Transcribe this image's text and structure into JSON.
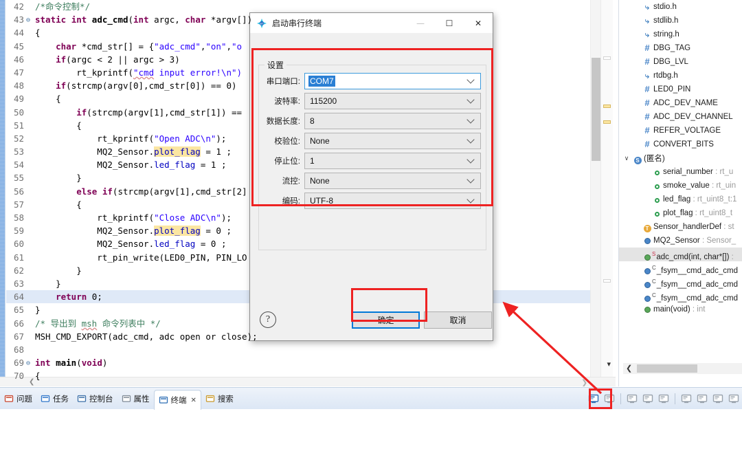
{
  "editor": {
    "lines": [
      {
        "num": "42",
        "fold": "",
        "current": false,
        "segs": [
          {
            "t": "/*命令控制*/",
            "c": "cmt"
          }
        ]
      },
      {
        "num": "43",
        "fold": "⊖",
        "current": false,
        "segs": [
          {
            "t": "static",
            "c": "kw"
          },
          {
            "t": " ",
            "c": "pln"
          },
          {
            "t": "int",
            "c": "kw"
          },
          {
            "t": " ",
            "c": "pln"
          },
          {
            "t": "adc_cmd",
            "c": "fn"
          },
          {
            "t": "(",
            "c": "pln"
          },
          {
            "t": "int",
            "c": "kw"
          },
          {
            "t": " argc, ",
            "c": "pln"
          },
          {
            "t": "char",
            "c": "kw"
          },
          {
            "t": " *argv[])",
            "c": "pln"
          }
        ]
      },
      {
        "num": "44",
        "fold": "",
        "current": false,
        "segs": [
          {
            "t": "{",
            "c": "pln"
          }
        ]
      },
      {
        "num": "45",
        "fold": "",
        "current": false,
        "segs": [
          {
            "t": "    ",
            "c": "pln"
          },
          {
            "t": "char",
            "c": "kw"
          },
          {
            "t": " *cmd_str[] = {",
            "c": "pln"
          },
          {
            "t": "\"adc_cmd\"",
            "c": "str"
          },
          {
            "t": ",",
            "c": "pln"
          },
          {
            "t": "\"on\"",
            "c": "str"
          },
          {
            "t": ",",
            "c": "pln"
          },
          {
            "t": "\"o",
            "c": "str"
          }
        ]
      },
      {
        "num": "46",
        "fold": "",
        "current": false,
        "segs": [
          {
            "t": "    ",
            "c": "pln"
          },
          {
            "t": "if",
            "c": "kw"
          },
          {
            "t": "(argc < 2 || argc > 3)",
            "c": "pln"
          }
        ]
      },
      {
        "num": "47",
        "fold": "",
        "current": false,
        "segs": [
          {
            "t": "        rt_kprintf(",
            "c": "pln"
          },
          {
            "t": "\"cmd",
            "c": "str wavy"
          },
          {
            "t": " input error!\\n\")",
            "c": "str"
          }
        ]
      },
      {
        "num": "48",
        "fold": "",
        "current": false,
        "segs": [
          {
            "t": "    ",
            "c": "pln"
          },
          {
            "t": "if",
            "c": "kw"
          },
          {
            "t": "(strcmp(argv[0],cmd_str[0]) == 0)",
            "c": "pln"
          }
        ]
      },
      {
        "num": "49",
        "fold": "",
        "current": false,
        "segs": [
          {
            "t": "    {",
            "c": "pln"
          }
        ]
      },
      {
        "num": "50",
        "fold": "",
        "current": false,
        "segs": [
          {
            "t": "        ",
            "c": "pln"
          },
          {
            "t": "if",
            "c": "kw"
          },
          {
            "t": "(strcmp(argv[1],cmd_str[1]) ==",
            "c": "pln"
          }
        ]
      },
      {
        "num": "51",
        "fold": "",
        "current": false,
        "segs": [
          {
            "t": "        {",
            "c": "pln"
          }
        ]
      },
      {
        "num": "52",
        "fold": "",
        "current": false,
        "segs": [
          {
            "t": "            rt_kprintf(",
            "c": "pln"
          },
          {
            "t": "\"Open ADC\\n\"",
            "c": "str"
          },
          {
            "t": ");",
            "c": "pln"
          }
        ]
      },
      {
        "num": "53",
        "fold": "",
        "current": false,
        "segs": [
          {
            "t": "            MQ2_Sensor.",
            "c": "pln"
          },
          {
            "t": "plot_flag",
            "c": "fld hl"
          },
          {
            "t": " = 1 ;",
            "c": "pln"
          }
        ]
      },
      {
        "num": "54",
        "fold": "",
        "current": false,
        "segs": [
          {
            "t": "            MQ2_Sensor.",
            "c": "pln"
          },
          {
            "t": "led_flag",
            "c": "fld"
          },
          {
            "t": " = 1 ;",
            "c": "pln"
          }
        ]
      },
      {
        "num": "55",
        "fold": "",
        "current": false,
        "segs": [
          {
            "t": "        }",
            "c": "pln"
          }
        ]
      },
      {
        "num": "56",
        "fold": "",
        "current": false,
        "segs": [
          {
            "t": "        ",
            "c": "pln"
          },
          {
            "t": "else",
            "c": "kw"
          },
          {
            "t": " ",
            "c": "pln"
          },
          {
            "t": "if",
            "c": "kw"
          },
          {
            "t": "(strcmp(argv[1],cmd_str[2]",
            "c": "pln"
          }
        ]
      },
      {
        "num": "57",
        "fold": "",
        "current": false,
        "segs": [
          {
            "t": "        {",
            "c": "pln"
          }
        ]
      },
      {
        "num": "58",
        "fold": "",
        "current": false,
        "segs": [
          {
            "t": "            rt_kprintf(",
            "c": "pln"
          },
          {
            "t": "\"Close ADC\\n\"",
            "c": "str"
          },
          {
            "t": ");",
            "c": "pln"
          }
        ]
      },
      {
        "num": "59",
        "fold": "",
        "current": false,
        "segs": [
          {
            "t": "            MQ2_Sensor.",
            "c": "pln"
          },
          {
            "t": "plot_flag",
            "c": "fld hl"
          },
          {
            "t": " = 0 ;",
            "c": "pln"
          }
        ]
      },
      {
        "num": "60",
        "fold": "",
        "current": false,
        "segs": [
          {
            "t": "            MQ2_Sensor.",
            "c": "pln"
          },
          {
            "t": "led_flag",
            "c": "fld"
          },
          {
            "t": " = 0 ;",
            "c": "pln"
          }
        ]
      },
      {
        "num": "61",
        "fold": "",
        "current": false,
        "segs": [
          {
            "t": "            rt_pin_write(LED0_PIN, PIN_LO",
            "c": "pln"
          }
        ]
      },
      {
        "num": "62",
        "fold": "",
        "current": false,
        "segs": [
          {
            "t": "        }",
            "c": "pln"
          }
        ]
      },
      {
        "num": "63",
        "fold": "",
        "current": false,
        "segs": [
          {
            "t": "    }",
            "c": "pln"
          }
        ]
      },
      {
        "num": "64",
        "fold": "",
        "current": true,
        "segs": [
          {
            "t": "    ",
            "c": "pln"
          },
          {
            "t": "return",
            "c": "kw"
          },
          {
            "t": " 0;",
            "c": "pln"
          }
        ]
      },
      {
        "num": "65",
        "fold": "",
        "current": false,
        "segs": [
          {
            "t": "}",
            "c": "pln"
          }
        ]
      },
      {
        "num": "66",
        "fold": "",
        "current": false,
        "segs": [
          {
            "t": "/* 导出到 ",
            "c": "cmt"
          },
          {
            "t": "msh",
            "c": "cmt wavy"
          },
          {
            "t": " 命令列表中 */",
            "c": "cmt"
          }
        ]
      },
      {
        "num": "67",
        "fold": "",
        "current": false,
        "segs": [
          {
            "t": "MSH_CMD_EXPORT(adc_cmd, adc open or close);",
            "c": "pln"
          }
        ]
      },
      {
        "num": "68",
        "fold": "",
        "current": false,
        "segs": [
          {
            "t": "",
            "c": "pln"
          }
        ]
      },
      {
        "num": "69",
        "fold": "⊖",
        "current": false,
        "segs": [
          {
            "t": "int",
            "c": "kw"
          },
          {
            "t": " ",
            "c": "pln"
          },
          {
            "t": "main",
            "c": "fn"
          },
          {
            "t": "(",
            "c": "pln"
          },
          {
            "t": "void",
            "c": "kw"
          },
          {
            "t": ")",
            "c": "pln"
          }
        ]
      },
      {
        "num": "70",
        "fold": "",
        "current": false,
        "segs": [
          {
            "t": "{",
            "c": "pln"
          }
        ]
      }
    ]
  },
  "outline": {
    "items": [
      {
        "indent": 1,
        "twisty": "",
        "icon": "include-icon",
        "iconGlyph": "⤷",
        "iconClass": "ic-hdr",
        "name": "stdio.h",
        "type": "",
        "selected": false
      },
      {
        "indent": 1,
        "twisty": "",
        "icon": "include-icon",
        "iconGlyph": "⤷",
        "iconClass": "ic-hdr",
        "name": "stdlib.h",
        "type": "",
        "selected": false
      },
      {
        "indent": 1,
        "twisty": "",
        "icon": "include-icon",
        "iconGlyph": "⤷",
        "iconClass": "ic-hdr",
        "name": "string.h",
        "type": "",
        "selected": false
      },
      {
        "indent": 1,
        "twisty": "",
        "icon": "define-icon",
        "iconGlyph": "#",
        "iconClass": "ic-def",
        "name": "DBG_TAG",
        "type": "",
        "selected": false
      },
      {
        "indent": 1,
        "twisty": "",
        "icon": "define-icon",
        "iconGlyph": "#",
        "iconClass": "ic-def",
        "name": "DBG_LVL",
        "type": "",
        "selected": false
      },
      {
        "indent": 1,
        "twisty": "",
        "icon": "include-icon",
        "iconGlyph": "⤷",
        "iconClass": "ic-hdr",
        "name": "rtdbg.h",
        "type": "",
        "selected": false
      },
      {
        "indent": 1,
        "twisty": "",
        "icon": "define-icon",
        "iconGlyph": "#",
        "iconClass": "ic-def",
        "name": "LED0_PIN",
        "type": "",
        "selected": false
      },
      {
        "indent": 1,
        "twisty": "",
        "icon": "define-icon",
        "iconGlyph": "#",
        "iconClass": "ic-def",
        "name": "ADC_DEV_NAME",
        "type": "",
        "selected": false
      },
      {
        "indent": 1,
        "twisty": "",
        "icon": "define-icon",
        "iconGlyph": "#",
        "iconClass": "ic-def",
        "name": "ADC_DEV_CHANNEL",
        "type": "",
        "selected": false
      },
      {
        "indent": 1,
        "twisty": "",
        "icon": "define-icon",
        "iconGlyph": "#",
        "iconClass": "ic-def",
        "name": "REFER_VOLTAGE",
        "type": "",
        "selected": false
      },
      {
        "indent": 1,
        "twisty": "",
        "icon": "define-icon",
        "iconGlyph": "#",
        "iconClass": "ic-def",
        "name": "CONVERT_BITS",
        "type": "",
        "selected": false
      },
      {
        "indent": 0,
        "twisty": "∨",
        "icon": "struct-icon",
        "iconGlyph": "S",
        "iconClass": "circ-s",
        "name": "(匿名)",
        "type": "",
        "selected": false
      },
      {
        "indent": 2,
        "twisty": "",
        "icon": "field-icon",
        "iconGlyph": "○",
        "iconClass": "dot-ring",
        "name": "serial_number",
        "type": " : rt_u",
        "selected": false
      },
      {
        "indent": 2,
        "twisty": "",
        "icon": "field-icon",
        "iconGlyph": "○",
        "iconClass": "dot-ring",
        "name": "smoke_value",
        "type": " : rt_uin",
        "selected": false
      },
      {
        "indent": 2,
        "twisty": "",
        "icon": "field-icon",
        "iconGlyph": "○",
        "iconClass": "dot-ring",
        "name": "led_flag",
        "type": " : rt_uint8_t:1",
        "selected": false
      },
      {
        "indent": 2,
        "twisty": "",
        "icon": "field-icon",
        "iconGlyph": "○",
        "iconClass": "dot-ring",
        "name": "plot_flag",
        "type": " : rt_uint8_t",
        "selected": false
      },
      {
        "indent": 1,
        "twisty": "",
        "icon": "typedef-icon",
        "iconGlyph": "T",
        "iconClass": "circ-t",
        "name": "Sensor_handlerDef",
        "type": " : st",
        "selected": false
      },
      {
        "indent": 1,
        "twisty": "",
        "icon": "variable-icon",
        "iconGlyph": "●",
        "iconClass": "dot-blue",
        "name": "MQ2_Sensor",
        "type": " : Sensor_",
        "selected": false
      },
      {
        "indent": 1,
        "twisty": "",
        "icon": "function-icon",
        "iconGlyph": "●",
        "iconClass": "dot-green",
        "name": "adc_cmd(int, char*[])",
        "type": " :",
        "badge": "S",
        "badgeClass": "badge-s",
        "selected": true
      },
      {
        "indent": 1,
        "twisty": "",
        "icon": "variable-icon",
        "iconGlyph": "●",
        "iconClass": "dot-blue",
        "name": "_fsym__cmd_adc_cmd",
        "type": "",
        "badge": "C",
        "badgeClass": "badge-c",
        "selected": false
      },
      {
        "indent": 1,
        "twisty": "",
        "icon": "variable-icon",
        "iconGlyph": "●",
        "iconClass": "dot-blue",
        "name": "_fsym__cmd_adc_cmd",
        "type": "",
        "badge": "C",
        "badgeClass": "badge-c",
        "selected": false
      },
      {
        "indent": 1,
        "twisty": "",
        "icon": "variable-icon",
        "iconGlyph": "●",
        "iconClass": "dot-blue",
        "name": "_fsym__cmd_adc_cmd",
        "type": "",
        "badge": "C",
        "badgeClass": "badge-c",
        "selected": false
      },
      {
        "indent": 1,
        "twisty": "",
        "icon": "function-icon",
        "iconGlyph": "●",
        "iconClass": "dot-green",
        "name": "main(void)",
        "type": " : int",
        "selected": false
      }
    ]
  },
  "dialog": {
    "title": "启动串行终端",
    "minimize_label": "—",
    "maximize_label": "☐",
    "close_label": "✕",
    "group_legend": "设置",
    "fields": [
      {
        "label": "串口端口:",
        "value": "COM7",
        "editable": true,
        "name": "serial-port"
      },
      {
        "label": "波特率:",
        "value": "115200",
        "editable": false,
        "name": "baud-rate"
      },
      {
        "label": "数据长度:",
        "value": "8",
        "editable": false,
        "name": "data-bits"
      },
      {
        "label": "校验位:",
        "value": "None",
        "editable": false,
        "name": "parity"
      },
      {
        "label": "停止位:",
        "value": "1",
        "editable": false,
        "name": "stop-bits"
      },
      {
        "label": "流控:",
        "value": "None",
        "editable": false,
        "name": "flow-control"
      },
      {
        "label": "编码:",
        "value": "UTF-8",
        "editable": false,
        "name": "encoding"
      }
    ],
    "help_label": "?",
    "ok_label": "确定",
    "cancel_label": "取消"
  },
  "bottom": {
    "tabs": [
      {
        "label": "问题",
        "icon": "problems-icon",
        "active": false,
        "closable": false
      },
      {
        "label": "任务",
        "icon": "tasks-icon",
        "active": false,
        "closable": false
      },
      {
        "label": "控制台",
        "icon": "console-icon",
        "active": false,
        "closable": false
      },
      {
        "label": "属性",
        "icon": "properties-icon",
        "active": false,
        "closable": false
      },
      {
        "label": "终端",
        "icon": "terminal-icon",
        "active": true,
        "closable": true,
        "close_label": "✕"
      },
      {
        "label": "搜索",
        "icon": "search-icon",
        "active": false,
        "closable": false
      }
    ],
    "toolbar": [
      {
        "name": "open-terminal-button",
        "highlighted": true
      },
      {
        "name": "connect-button",
        "highlighted": false
      },
      {
        "name": "separator-1",
        "separator": true
      },
      {
        "name": "copy-button",
        "highlighted": false
      },
      {
        "name": "paste-special-button",
        "highlighted": false
      },
      {
        "name": "layout-button",
        "highlighted": false
      },
      {
        "name": "separator-2",
        "separator": true
      },
      {
        "name": "copy-all-button",
        "highlighted": false
      },
      {
        "name": "clear-button",
        "highlighted": false
      },
      {
        "name": "settings-button",
        "highlighted": false
      },
      {
        "name": "minimize-view-button",
        "highlighted": false
      }
    ]
  },
  "annotations": {
    "accent_red": "#ee2222",
    "accent_blue": "#0078d7"
  }
}
